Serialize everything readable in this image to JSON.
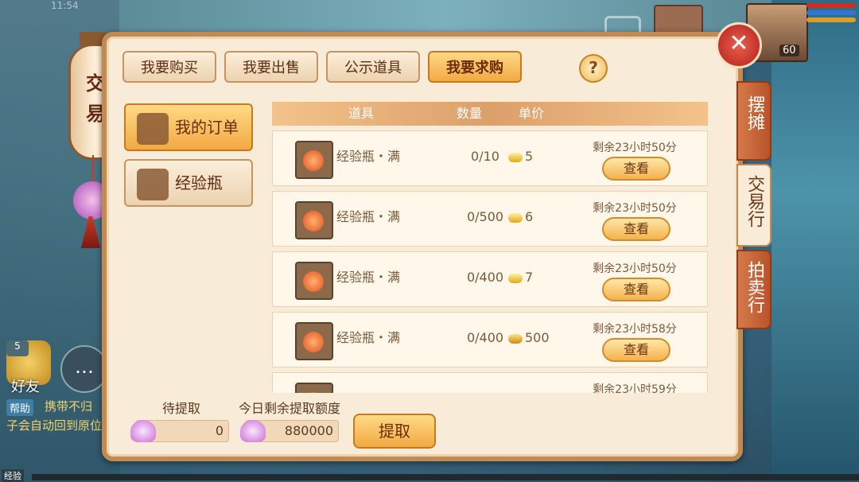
{
  "status": {
    "time": "11:54"
  },
  "hud": {
    "level": "60"
  },
  "lantern": {
    "chars": [
      "交",
      "易"
    ]
  },
  "tabs_top": [
    {
      "label": "我要购买",
      "active": false
    },
    {
      "label": "我要出售",
      "active": false
    },
    {
      "label": "公示道具",
      "active": false
    },
    {
      "label": "我要求购",
      "active": true
    }
  ],
  "help_label": "?",
  "side_menu": [
    {
      "label": "我的订单",
      "icon": "clipboard-icon",
      "active": true
    },
    {
      "label": "经验瓶",
      "icon": "bottle-icon",
      "active": false
    }
  ],
  "table": {
    "headers": {
      "item": "道具",
      "qty": "数量",
      "price": "单价"
    },
    "rows": [
      {
        "name": "经验瓶・满",
        "qty": "0/10",
        "price": "5",
        "remain": "剩余23小时50分",
        "action": "查看"
      },
      {
        "name": "经验瓶・满",
        "qty": "0/500",
        "price": "6",
        "remain": "剩余23小时50分",
        "action": "查看"
      },
      {
        "name": "经验瓶・满",
        "qty": "0/400",
        "price": "7",
        "remain": "剩余23小时50分",
        "action": "查看"
      },
      {
        "name": "经验瓶・满",
        "qty": "0/400",
        "price": "500",
        "remain": "剩余23小时58分",
        "action": "查看"
      },
      {
        "name": "",
        "qty": "",
        "price": "",
        "remain": "剩余23小时59分",
        "action": ""
      }
    ]
  },
  "bottom": {
    "pending_label": "待提取",
    "pending_value": "0",
    "quota_label": "今日剩余提取额度",
    "quota_value": "880000",
    "extract_label": "提取"
  },
  "close_label": "✕",
  "right_tabs": [
    {
      "label": "摆摊",
      "active": false
    },
    {
      "label": "交易行",
      "active": true
    },
    {
      "label": "拍卖行",
      "active": false
    }
  ],
  "left_hud": {
    "friend_count": "5",
    "friend_label": "好友",
    "help_tag": "帮助",
    "chat_line1": "携带不归",
    "chat_line2": "子会自动回到原位",
    "exp_label": "经验"
  },
  "colors": {
    "accent": "#f2a944",
    "panel": "#f8ecd9",
    "border": "#c08a52"
  }
}
